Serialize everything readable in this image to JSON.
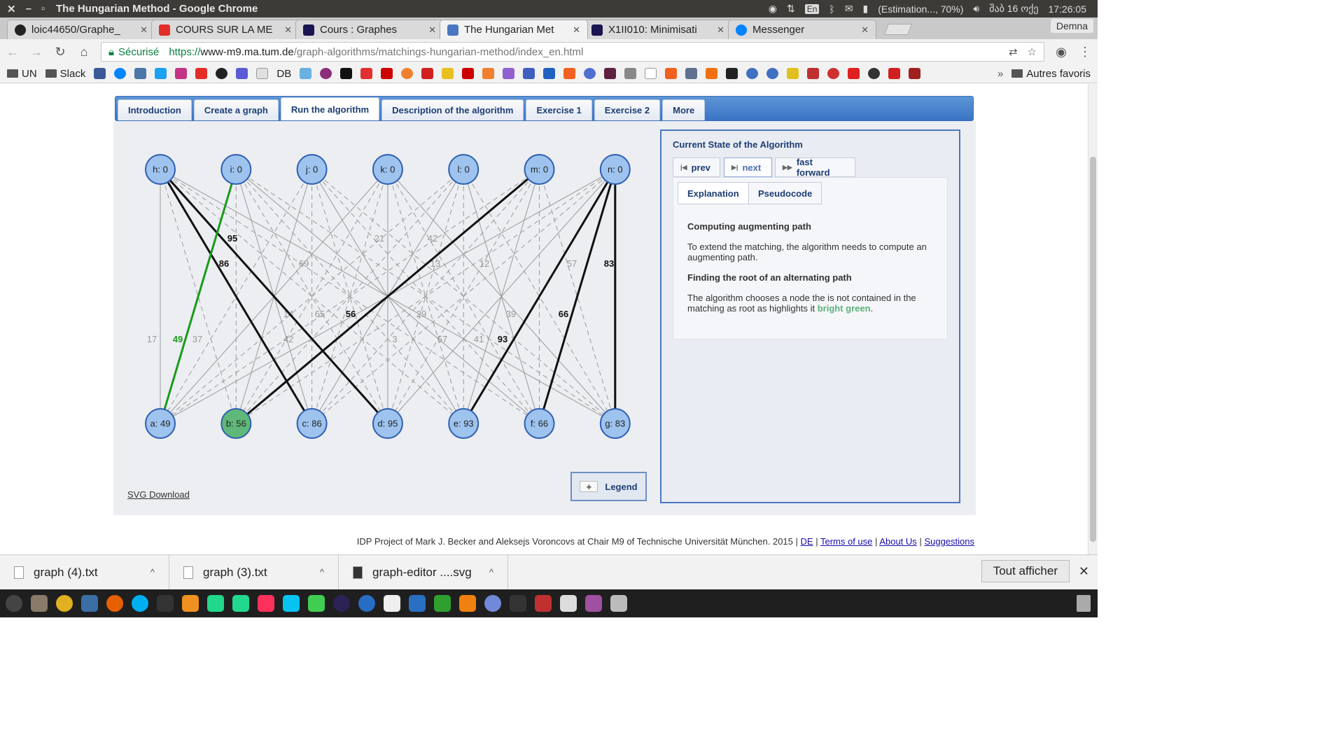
{
  "os": {
    "window_title": "The Hungarian Method - Google Chrome",
    "lang": "En",
    "battery": "(Estimation..., 70%)",
    "date": "შაბ 16 ოქე",
    "time": "17:26:05",
    "profile": "Demna"
  },
  "tabs": [
    {
      "label": "loic44650/Graphe_",
      "color": "#222222"
    },
    {
      "label": "COURS SUR LA ME",
      "color": "#e52d27"
    },
    {
      "label": "Cours : Graphes",
      "color": "#1a1450"
    },
    {
      "label": "The Hungarian Met",
      "color": "#4a78c0",
      "active": true
    },
    {
      "label": "X1II010: Minimisati",
      "color": "#1a1450"
    },
    {
      "label": "Messenger",
      "color": "#0084ff"
    }
  ],
  "address": {
    "secure_label": "Sécurisé",
    "scheme": "https://",
    "host": "www-m9.ma.tum.de",
    "path": "/graph-algorithms/matchings-hungarian-method/index_en.html"
  },
  "bookmarks": {
    "folders": [
      "UN",
      "Slack"
    ],
    "db_label": "DB",
    "other": "Autres favoris",
    "more": "»"
  },
  "nav": {
    "tabs": [
      "Introduction",
      "Create a graph",
      "Run the algorithm",
      "Description of the algorithm",
      "Exercise 1",
      "Exercise 2",
      "More"
    ],
    "active": "Run the algorithm"
  },
  "graph": {
    "top_nodes": [
      "h: 0",
      "i: 0",
      "j: 0",
      "k: 0",
      "l: 0",
      "m: 0",
      "n: 0"
    ],
    "bottom_nodes": [
      "a: 49",
      "b: 56",
      "c: 86",
      "d: 95",
      "e: 93",
      "f: 66",
      "g: 83"
    ],
    "highlighted_node": "b",
    "matching_edges": [
      {
        "from": "h",
        "to": "c",
        "weight": "86"
      },
      {
        "from": "h",
        "to": "d",
        "weight": "95"
      },
      {
        "from": "m",
        "to": "b",
        "weight": "56"
      },
      {
        "from": "n",
        "to": "e",
        "weight": "93"
      },
      {
        "from": "n",
        "to": "f",
        "weight": "66"
      },
      {
        "from": "n",
        "to": "g",
        "weight": "83"
      }
    ],
    "green_edge": {
      "from": "i",
      "to": "a",
      "weight": "49"
    },
    "grey_labels": [
      "17",
      "37",
      "69",
      "21",
      "42",
      "13",
      "12",
      "57",
      "14",
      "65",
      "29",
      "39",
      "42",
      "3",
      "57",
      "41"
    ],
    "svg_download": "SVG Download",
    "legend_label": "Legend",
    "legend_plus": "+"
  },
  "state": {
    "title": "Current State of the Algorithm",
    "prev": "prev",
    "next": "next",
    "fast_forward": "fast forward",
    "tab_explanation": "Explanation",
    "tab_pseudocode": "Pseudocode",
    "h1": "Computing augmenting path",
    "p1": "To extend the matching, the algorithm needs to compute an augmenting path.",
    "h2": "Finding the root of an alternating path",
    "p2_start": "The algorithm chooses a node the is not contained in the matching as root as highlights it ",
    "p2_green": "bright green",
    "p2_end": "."
  },
  "footer": {
    "text": "IDP Project of Mark J. Becker and Aleksejs Voroncovs at Chair M9 of Technische Universität München. 2015 |",
    "de": "DE",
    "sep": "|",
    "terms": "Terms of use",
    "about": "About Us",
    "suggestions": "Suggestions"
  },
  "downloads": {
    "items": [
      "graph (4).txt",
      "graph (3).txt",
      "graph-editor ....svg"
    ],
    "show_all": "Tout afficher"
  }
}
